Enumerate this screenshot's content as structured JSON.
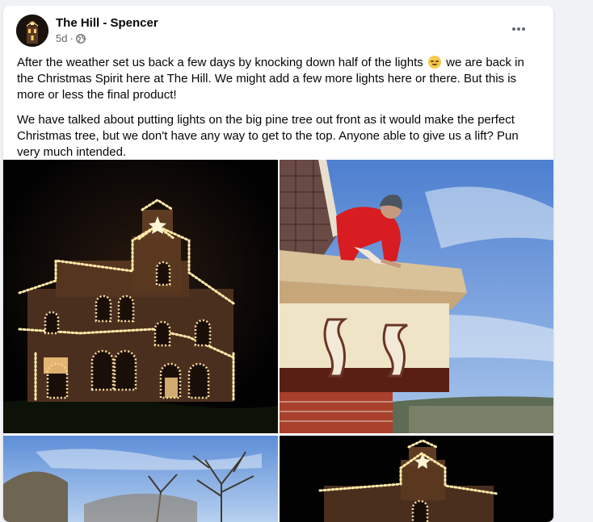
{
  "post": {
    "page_name": "The Hill - Spencer",
    "time": "5d",
    "separator": "·",
    "privacy_icon": "globe-icon",
    "more_icon": "more-horizontal-icon",
    "paragraphs": {
      "p1_before": "After the weather set us back a few days by knocking down half of the lights",
      "p1_emoji": "relieved-face-emoji",
      "p1_after": "we are back in the Christmas Spirit here at The Hill. We might add a few more lights here or there. But this is more or less the final product!",
      "p2": "We have talked about putting lights on the big pine tree out front as it would make the perfect Christmas tree, but we don't have any way to get to the top. Anyone able to give us a lift? Pun very much intended."
    },
    "colors": {
      "text": "#050505",
      "meta": "#65676b",
      "background": "#f0f2f5",
      "card": "#ffffff",
      "lights": "#ffe9a8"
    }
  }
}
